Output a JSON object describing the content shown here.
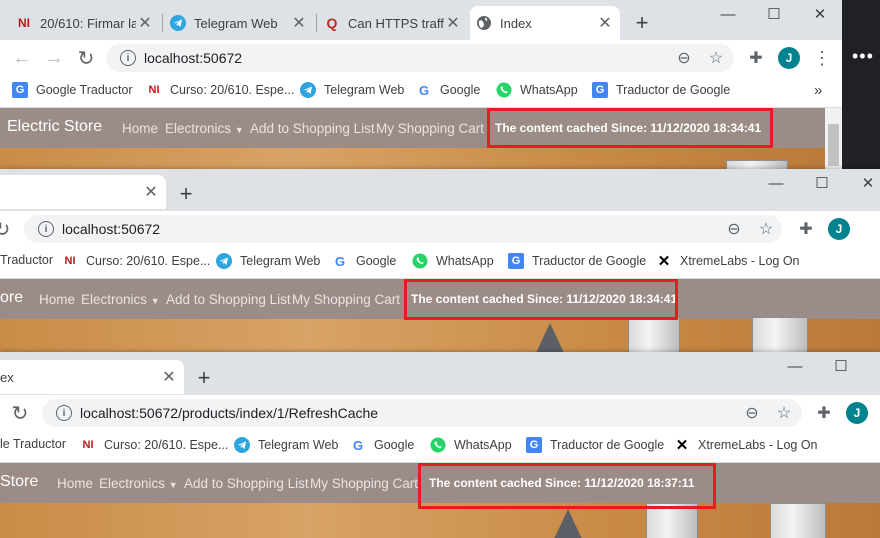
{
  "top": {
    "tabs": [
      {
        "title": "20/610: Firmar la",
        "favicon": "NI",
        "close": "✕"
      },
      {
        "title": "Telegram Web",
        "favicon": "telegram-icon",
        "close": "✕"
      },
      {
        "title": "Can HTTPS traffic",
        "favicon": "Q",
        "close": "✕"
      },
      {
        "title": "Index",
        "favicon": "globe-icon",
        "close": "✕"
      }
    ],
    "new_tab": "+",
    "window": {
      "minimize": "—",
      "maximize": "☐",
      "close": "✕"
    },
    "url": "localhost:50672",
    "bookmarks": [
      "Google Traductor",
      "Curso: 20/610. Espe...",
      "Telegram Web",
      "Google",
      "WhatsApp",
      "Traductor de Google"
    ],
    "bookmarks_more": "»",
    "avatar": "J",
    "menu": "⋮",
    "brand": "Electric Store",
    "nav": [
      "Home",
      "Electronics",
      "Add to Shopping List",
      "My Shopping Cart"
    ],
    "cache_text": "The content cached Since: 11/12/2020 18:34:41",
    "side_more": "•••"
  },
  "middle": {
    "tab_close": "✕",
    "new_tab": "+",
    "window": {
      "minimize": "—",
      "maximize": "☐",
      "close": "✕"
    },
    "url": "localhost:50672",
    "bookmarks": [
      "Traductor",
      "Curso: 20/610. Espe...",
      "Telegram Web",
      "Google",
      "WhatsApp",
      "Traductor de Google",
      "XtremeLabs - Log On"
    ],
    "avatar": "J",
    "brand": "ore",
    "nav": [
      "Home",
      "Electronics",
      "Add to Shopping List",
      "My Shopping Cart"
    ],
    "cache_text": "The content cached Since: 11/12/2020 18:34:41"
  },
  "bottom": {
    "tab_title": "ex",
    "tab_close": "✕",
    "new_tab": "+",
    "window": {
      "minimize": "—",
      "maximize": "☐"
    },
    "url": "localhost:50672/products/index/1/RefreshCache",
    "bookmarks": [
      "le Traductor",
      "Curso: 20/610. Espe...",
      "Telegram Web",
      "Google",
      "WhatsApp",
      "Traductor de Google",
      "XtremeLabs - Log On"
    ],
    "avatar": "J",
    "brand": "Store",
    "nav": [
      "Home",
      "Electronics",
      "Add to Shopping List",
      "My Shopping Cart"
    ],
    "cache_text": "The content cached Since: 11/12/2020 18:37:11"
  },
  "colors": {
    "highlight": "#e81b22",
    "navbar": "#9b8c88",
    "tabstrip": "#dee1e6"
  }
}
